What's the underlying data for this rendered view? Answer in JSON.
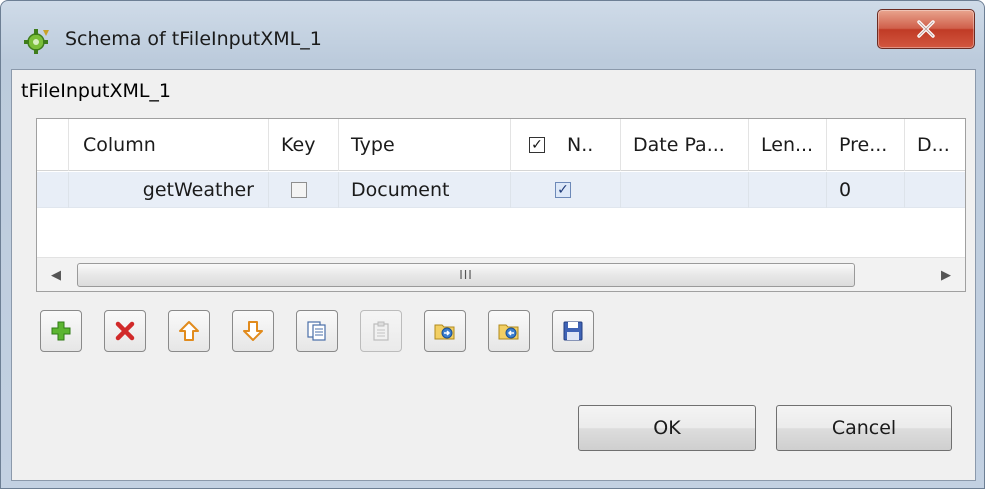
{
  "window": {
    "title": "Schema of tFileInputXML_1",
    "close_glyph": "X",
    "group_label": "tFileInputXML_1"
  },
  "table": {
    "headers": [
      "Column",
      "Key",
      "Type",
      "N..",
      "Date Pa...",
      "Len...",
      "Pre...",
      "D..."
    ],
    "rows": [
      {
        "column": "getWeather",
        "key": false,
        "type": "Document",
        "nullable": true,
        "date_pattern": "",
        "length": "",
        "precision": "0",
        "default": ""
      }
    ],
    "scroll_thumb_grip": "III",
    "scroll_left": "◀",
    "scroll_right": "▶"
  },
  "toolbar": {
    "icons": [
      "add-icon",
      "delete-icon",
      "move-up-icon",
      "move-down-icon",
      "copy-icon",
      "paste-icon",
      "import-icon",
      "export-icon",
      "save-icon"
    ]
  },
  "buttons": {
    "ok": "OK",
    "cancel": "Cancel"
  }
}
